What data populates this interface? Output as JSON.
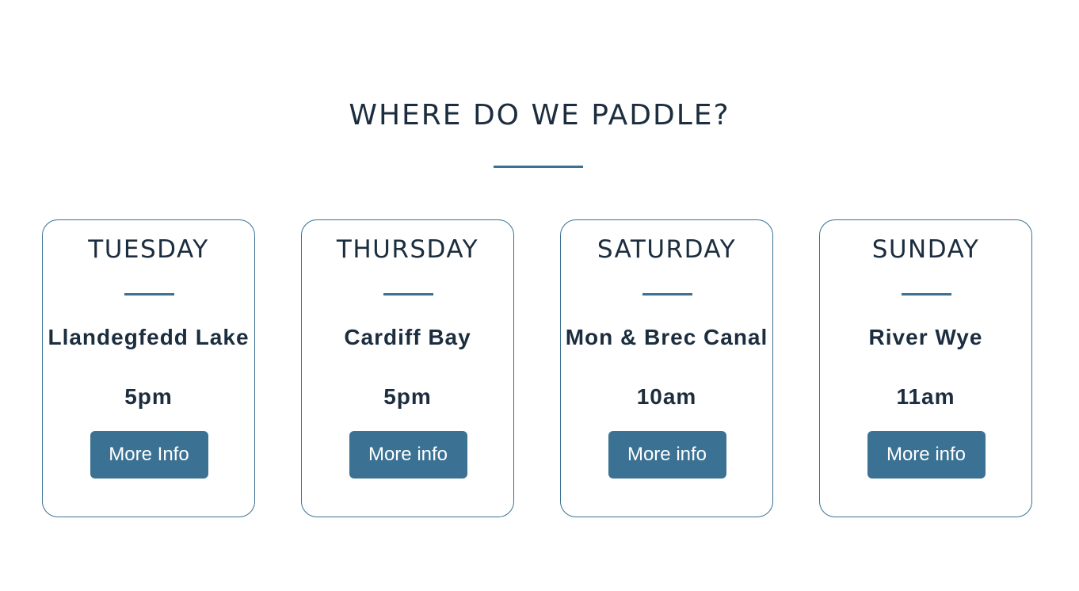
{
  "section": {
    "title": "WHERE DO WE PADDLE?"
  },
  "cards": [
    {
      "day": "TUESDAY",
      "location": "Llandegfedd Lake",
      "time": "5pm",
      "button_label": "More Info"
    },
    {
      "day": "THURSDAY",
      "location": "Cardiff Bay",
      "time": "5pm",
      "button_label": "More info"
    },
    {
      "day": "SATURDAY",
      "location": "Mon & Brec Canal",
      "time": "10am",
      "button_label": "More info"
    },
    {
      "day": "SUNDAY",
      "location": "River Wye",
      "time": "11am",
      "button_label": "More info"
    }
  ],
  "colors": {
    "accent": "#3b7193",
    "text": "#1b2d3e",
    "background": "#ffffff"
  }
}
